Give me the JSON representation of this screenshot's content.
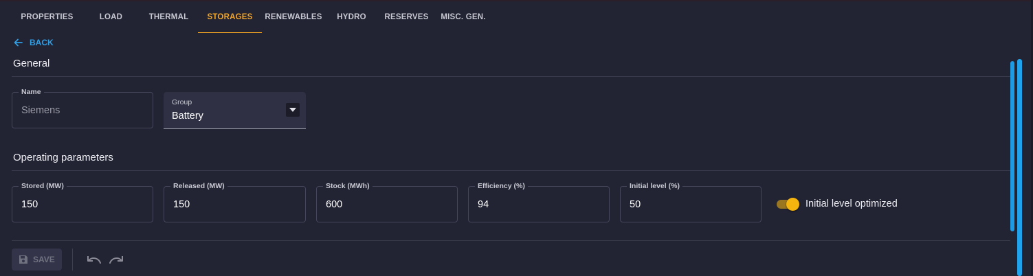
{
  "tabs": [
    {
      "label": "PROPERTIES",
      "active": false
    },
    {
      "label": "LOAD",
      "active": false
    },
    {
      "label": "THERMAL",
      "active": false
    },
    {
      "label": "STORAGES",
      "active": true
    },
    {
      "label": "RENEWABLES",
      "active": false
    },
    {
      "label": "HYDRO",
      "active": false
    },
    {
      "label": "RESERVES",
      "active": false
    },
    {
      "label": "MISC. GEN.",
      "active": false
    }
  ],
  "back_label": "BACK",
  "general": {
    "title": "General",
    "name": {
      "label": "Name",
      "value": "Siemens"
    },
    "group": {
      "label": "Group",
      "value": "Battery"
    }
  },
  "operating": {
    "title": "Operating parameters",
    "fields": [
      {
        "label": "Stored (MW)",
        "value": "150"
      },
      {
        "label": "Released (MW)",
        "value": "150"
      },
      {
        "label": "Stock (MWh)",
        "value": "600"
      },
      {
        "label": "Efficiency (%)",
        "value": "94"
      },
      {
        "label": "Initial level (%)",
        "value": "50"
      }
    ],
    "toggle": {
      "label": "Initial level optimized",
      "on": true
    }
  },
  "footer": {
    "save_label": "SAVE"
  },
  "colors": {
    "accent": "#f5a623",
    "link": "#2f9fe6",
    "background": "#222333",
    "scrollbar": "#1fa3ec"
  },
  "icons": [
    "arrow-left-icon",
    "chevron-down-icon",
    "save-icon",
    "undo-icon",
    "redo-icon"
  ]
}
